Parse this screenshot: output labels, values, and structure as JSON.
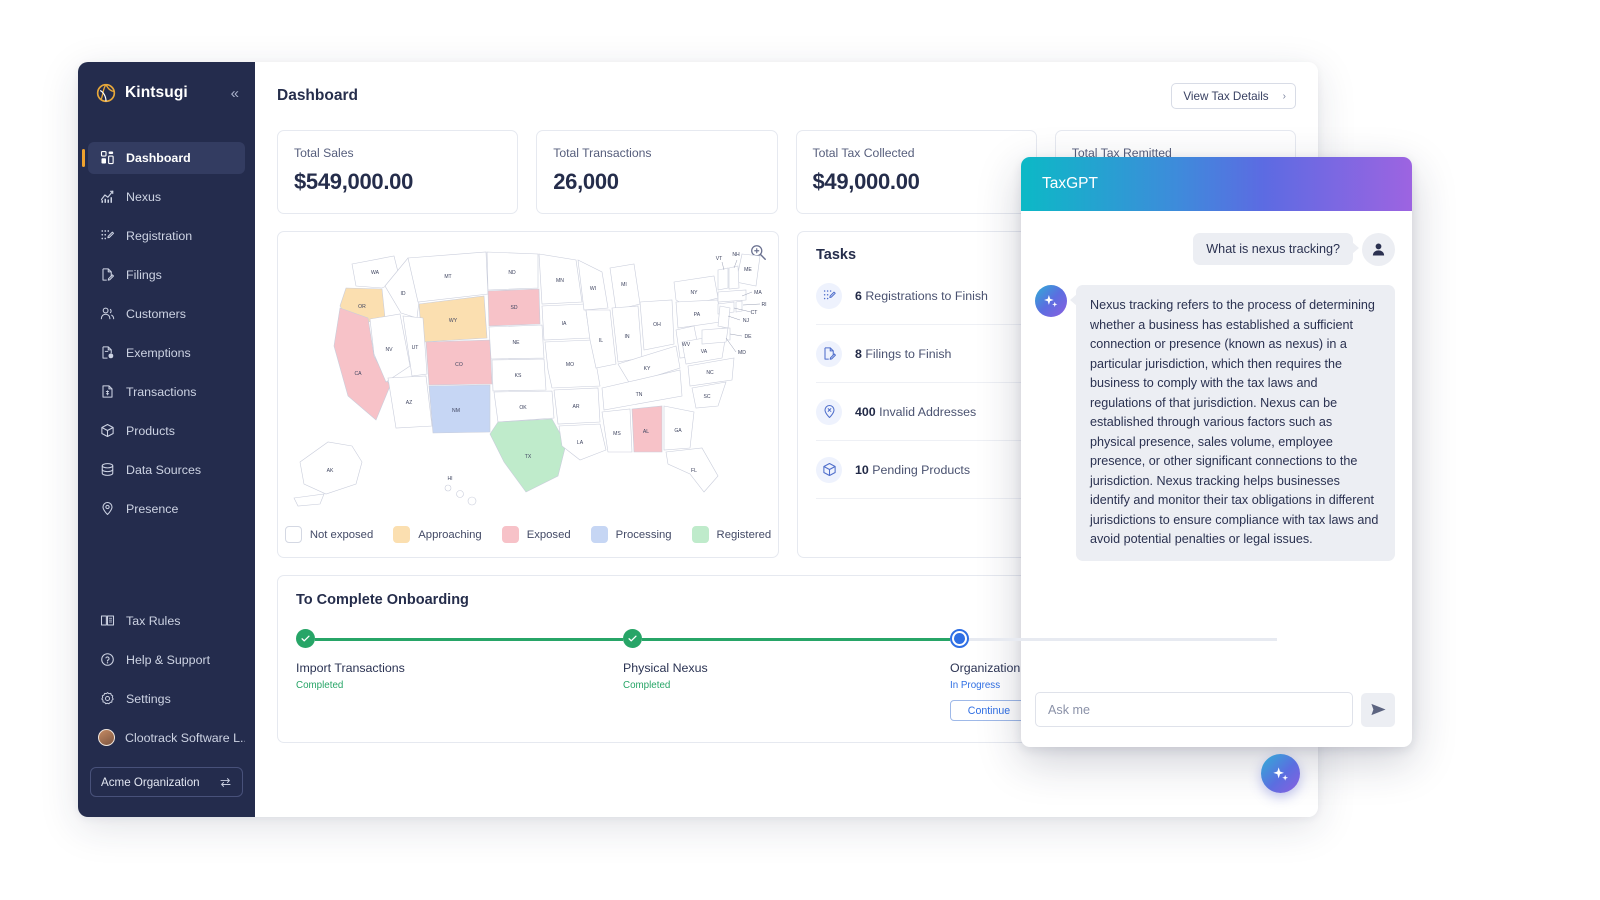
{
  "sidebar": {
    "brand": "Kintsugi",
    "collapse_icon": "chevrons-left-icon",
    "items": [
      {
        "label": "Dashboard",
        "icon": "grid-dashboard-icon",
        "active": true
      },
      {
        "label": "Nexus",
        "icon": "chart-trend-icon",
        "active": false
      },
      {
        "label": "Registration",
        "icon": "dots-pencil-icon",
        "active": false
      },
      {
        "label": "Filings",
        "icon": "file-pencil-icon",
        "active": false
      },
      {
        "label": "Customers",
        "icon": "people-icon",
        "active": false
      },
      {
        "label": "Exemptions",
        "icon": "file-info-icon",
        "active": false
      },
      {
        "label": "Transactions",
        "icon": "file-dollar-icon",
        "active": false
      },
      {
        "label": "Products",
        "icon": "box-icon",
        "active": false
      },
      {
        "label": "Data Sources",
        "icon": "database-icon",
        "active": false
      },
      {
        "label": "Presence",
        "icon": "map-pin-icon",
        "active": false
      }
    ],
    "bottom_items": [
      {
        "label": "Tax Rules",
        "icon": "book-icon"
      },
      {
        "label": "Help & Support",
        "icon": "question-circle-icon"
      },
      {
        "label": "Settings",
        "icon": "gear-icon"
      }
    ],
    "account_name": "Clootrack Software L...",
    "organization": "Acme Organization",
    "org_switch_icon": "swap-arrows-icon"
  },
  "header": {
    "title": "Dashboard",
    "view_tax_details": "View Tax Details",
    "chevron": "›"
  },
  "kpis": [
    {
      "label": "Total Sales",
      "value": "$549,000.00"
    },
    {
      "label": "Total Transactions",
      "value": "26,000"
    },
    {
      "label": "Total Tax Collected",
      "value": "$49,000.00"
    },
    {
      "label": "Total Tax Remitted",
      "value": ""
    }
  ],
  "map": {
    "zoom_icon": "magnifier-plus-icon",
    "legend": [
      {
        "label": "Not exposed",
        "color": "#ffffff"
      },
      {
        "label": "Approaching",
        "color": "#FBDFB0"
      },
      {
        "label": "Exposed",
        "color": "#F7C2C8"
      },
      {
        "label": "Processing",
        "color": "#C6D6F4"
      },
      {
        "label": "Registered",
        "color": "#BFEBCB"
      }
    ],
    "state_status": {
      "OR": "Approaching",
      "WY": "Approaching",
      "CA": "Exposed",
      "CO": "Exposed",
      "SD": "Exposed",
      "AL": "Exposed",
      "NM": "Processing",
      "TX": "Registered"
    }
  },
  "tasks": {
    "title": "Tasks",
    "items": [
      {
        "count": "6",
        "label": "Registrations to Finish",
        "icon": "dots-pencil-icon"
      },
      {
        "count": "8",
        "label": "Filings to Finish",
        "icon": "file-pencil-icon"
      },
      {
        "count": "400",
        "label": "Invalid Addresses",
        "icon": "pin-x-icon"
      },
      {
        "count": "10",
        "label": "Pending Products",
        "icon": "box-icon"
      }
    ]
  },
  "onboarding": {
    "title": "To Complete Onboarding",
    "steps": [
      {
        "name": "Import Transactions",
        "status": "Completed",
        "state": "done"
      },
      {
        "name": "Physical Nexus",
        "status": "Completed",
        "state": "done"
      },
      {
        "name": "Organization Details",
        "status": "In Progress",
        "state": "current",
        "action": "Continue"
      }
    ]
  },
  "chat": {
    "title": "TaxGPT",
    "user_avatar_icon": "person-icon",
    "bot_avatar_icon": "sparkle-icon",
    "messages": [
      {
        "role": "user",
        "text": "What is nexus tracking?"
      },
      {
        "role": "bot",
        "text": "Nexus tracking refers to the process of determining whether a business has established a sufficient connection or presence (known as nexus) in a particular jurisdiction, which then requires the business to comply with the tax laws and regulations of that jurisdiction. Nexus can be established through various factors such as physical presence, sales volume, employee presence, or other significant connections to the jurisdiction. Nexus tracking helps businesses identify and monitor their tax obligations in different jurisdictions to ensure compliance with tax laws and avoid potential penalties or legal issues."
      }
    ],
    "input_placeholder": "Ask me",
    "input_value": "",
    "send_icon": "send-paper-plane-icon",
    "fab_icon": "sparkle-icon"
  },
  "colors": {
    "sidebar_bg": "#242C4D",
    "accent": "#F0A22E",
    "primary_blue": "#2F6FE4",
    "success_green": "#27A567"
  }
}
